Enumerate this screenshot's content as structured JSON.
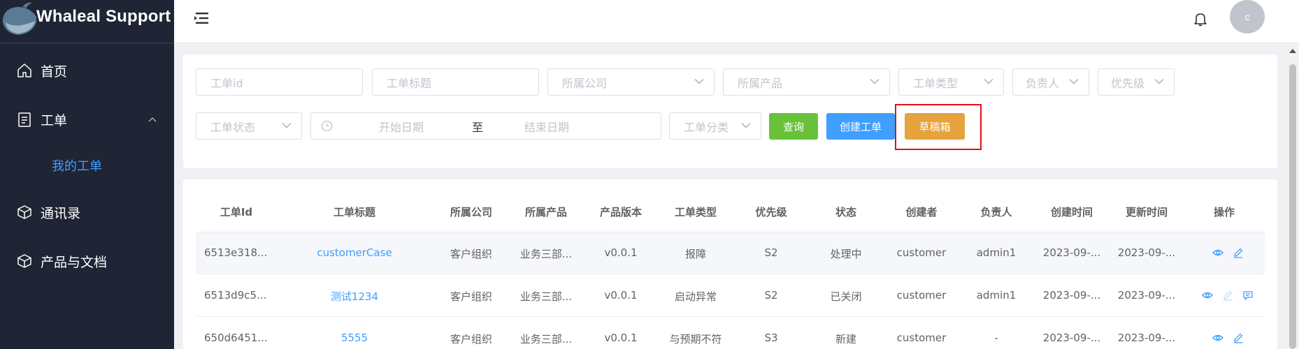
{
  "app": {
    "brand": "Whaleal Support"
  },
  "sidebar": {
    "items": [
      {
        "label": "首页",
        "icon": "home-icon"
      },
      {
        "label": "工单",
        "icon": "clipboard-icon"
      },
      {
        "label": "我的工单"
      },
      {
        "label": "通讯录",
        "icon": "cube-icon"
      },
      {
        "label": "产品与文档",
        "icon": "cube-icon"
      }
    ]
  },
  "header": {
    "avatar_initial": "c"
  },
  "filters": {
    "ticket_id": "工单id",
    "ticket_title": "工单标题",
    "company": "所属公司",
    "product": "所属产品",
    "ticket_type": "工单类型",
    "owner": "负责人",
    "priority": "优先级",
    "status": "工单状态",
    "start_date": "开始日期",
    "date_sep": "至",
    "end_date": "结束日期",
    "category": "工单分类",
    "query_btn": "查询",
    "create_btn": "创建工单",
    "drafts_btn": "草稿箱"
  },
  "table": {
    "columns": [
      "工单Id",
      "工单标题",
      "所属公司",
      "所属产品",
      "产品版本",
      "工单类型",
      "优先级",
      "状态",
      "创建者",
      "负责人",
      "创建时间",
      "更新时间",
      "操作"
    ],
    "rows": [
      [
        "6513e318...",
        "customerCase",
        "客户组织",
        "业务三部...",
        "v0.0.1",
        "报障",
        "S2",
        "处理中",
        "customer",
        "admin1",
        "2023-09-...",
        "2023-09-..."
      ],
      [
        "6513d9c5...",
        "测试1234",
        "客户组织",
        "业务三部...",
        "v0.0.1",
        "启动异常",
        "S2",
        "已关闭",
        "customer",
        "admin1",
        "2023-09-...",
        "2023-09-..."
      ],
      [
        "650d6451...",
        "5555",
        "客户组织",
        "业务三部...",
        "v0.0.1",
        "与预期不符",
        "S3",
        "新建",
        "customer",
        "-",
        "2023-09-...",
        "2023-09-..."
      ]
    ]
  },
  "colors": {
    "primary": "#409eff",
    "success": "#67c23a",
    "warning": "#e6a23c",
    "sidebar": "#1f2535",
    "highlight": "#e0101b"
  }
}
